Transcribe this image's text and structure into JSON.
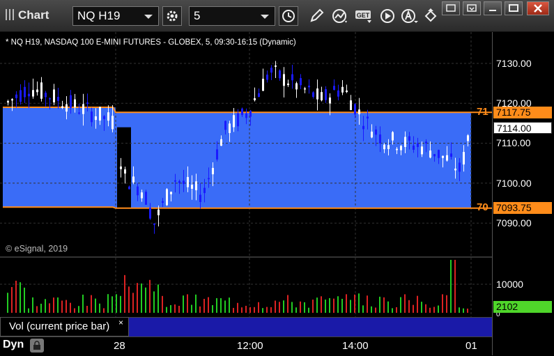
{
  "header": {
    "title": "Chart",
    "symbol": "NQ H19",
    "interval": "5"
  },
  "chart": {
    "info": "* NQ H19, NASDAQ 100 E-MINI FUTURES - GLOBEX, 5, 09:30-16:15 (Dynamic)",
    "copyright": "© eSignal, 2019",
    "price_ticks": [
      "7130.00",
      "7120.00",
      "7110.00",
      "7100.00",
      "7090.00"
    ],
    "upper_level": {
      "tag": "71",
      "price": "7117.75"
    },
    "lower_level": {
      "tag": "70",
      "price": "7093.75"
    },
    "last_price": "7114.00",
    "time_ticks": [
      "28",
      "12:00",
      "14:00",
      "01"
    ],
    "colors": {
      "zone": "#3a6cf7",
      "level_line": "#ff8c1a",
      "up": "#ffffff",
      "down": "#1a1aff"
    }
  },
  "volume": {
    "legend": "Vol (current price bar)",
    "close_label": "×",
    "ticks": [
      "10000",
      "0"
    ],
    "current": "2102",
    "colors": {
      "up": "#22cc22",
      "down": "#dd2222",
      "badge": "#4fd62a"
    }
  },
  "footer": {
    "mode": "Dyn"
  }
}
